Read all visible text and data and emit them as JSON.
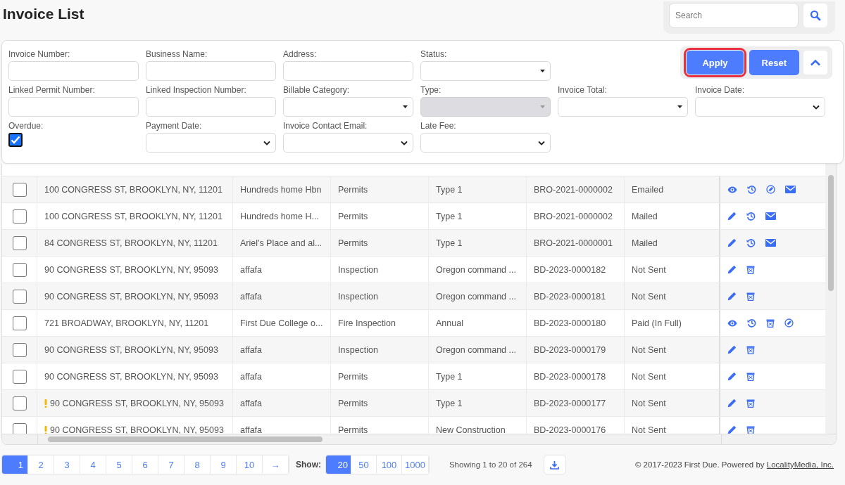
{
  "title": "Invoice List",
  "search": {
    "placeholder": "Search"
  },
  "filters": [
    {
      "label": "Invoice Number:",
      "kind": "text"
    },
    {
      "label": "Business Name:",
      "kind": "text"
    },
    {
      "label": "Address:",
      "kind": "text"
    },
    {
      "label": "Status:",
      "kind": "dropdown",
      "disabled": false
    },
    {
      "label": "Linked Permit Number:",
      "kind": "text"
    },
    {
      "label": "Linked Inspection Number:",
      "kind": "text"
    },
    {
      "label": "Billable Category:",
      "kind": "dropdown",
      "disabled": false
    },
    {
      "label": "Type:",
      "kind": "dropdown",
      "disabled": true
    },
    {
      "label": "Invoice Total:",
      "kind": "dropdown",
      "disabled": false
    },
    {
      "label": "Invoice Date:",
      "kind": "select",
      "disabled": false
    },
    {
      "label": "Overdue:",
      "kind": "checkbox",
      "checked": true
    },
    {
      "label": "Payment Date:",
      "kind": "select",
      "disabled": false
    },
    {
      "label": "Invoice Contact Email:",
      "kind": "select",
      "disabled": false
    },
    {
      "label": "Late Fee:",
      "kind": "select",
      "disabled": false
    }
  ],
  "filter_buttons": [
    {
      "label": "Apply",
      "focused": true
    },
    {
      "label": "Reset",
      "focused": false
    }
  ],
  "rows": [
    {
      "checked": false,
      "warning": false,
      "address": "100 CONGRESS ST, BROOKLYN, NY, 11201",
      "business": "Hundreds home Hbn",
      "category": "Permits",
      "type": "Type 1",
      "number": "BRO-2021-0000002",
      "status": "Emailed",
      "actions": [
        {
          "kind": "view"
        },
        {
          "kind": "history"
        },
        {
          "kind": "paid"
        },
        {
          "kind": "email"
        }
      ]
    },
    {
      "checked": false,
      "warning": false,
      "address": "100 CONGRESS ST, BROOKLYN, NY, 11201",
      "business": "Hundreds home H...",
      "category": "Permits",
      "type": "Type 1",
      "number": "BRO-2021-0000002",
      "status": "Mailed",
      "actions": [
        {
          "kind": "edit"
        },
        {
          "kind": "history"
        },
        {
          "kind": "email"
        }
      ]
    },
    {
      "checked": false,
      "warning": false,
      "address": "84 CONGRESS ST, BROOKLYN, NY, 11201",
      "business": "Ariel's Place and al...",
      "category": "Permits",
      "type": "Type 1",
      "number": "BRO-2021-0000001",
      "status": "Mailed",
      "actions": [
        {
          "kind": "edit"
        },
        {
          "kind": "history"
        },
        {
          "kind": "email"
        }
      ]
    },
    {
      "checked": false,
      "warning": false,
      "address": "90 CONGRESS ST, BROOKLYN, NY, 95093",
      "business": "affafa",
      "category": "Inspection",
      "type": "Oregon command ...",
      "number": "BD-2023-0000182",
      "status": "Not Sent",
      "actions": [
        {
          "kind": "edit"
        },
        {
          "kind": "delete"
        }
      ]
    },
    {
      "checked": false,
      "warning": false,
      "address": "90 CONGRESS ST, BROOKLYN, NY, 95093",
      "business": "affafa",
      "category": "Inspection",
      "type": "Oregon command ...",
      "number": "BD-2023-0000181",
      "status": "Not Sent",
      "actions": [
        {
          "kind": "edit"
        },
        {
          "kind": "delete"
        }
      ]
    },
    {
      "checked": false,
      "warning": false,
      "address": "721 BROADWAY, BROOKLYN, NY, 11201",
      "business": "First Due College o...",
      "category": "Fire Inspection",
      "type": "Annual",
      "number": "BD-2023-0000180",
      "status": "Paid (In Full)",
      "actions": [
        {
          "kind": "view"
        },
        {
          "kind": "history"
        },
        {
          "kind": "delete"
        },
        {
          "kind": "paid"
        }
      ]
    },
    {
      "checked": false,
      "warning": false,
      "address": "90 CONGRESS ST, BROOKLYN, NY, 95093",
      "business": "affafa",
      "category": "Inspection",
      "type": "Oregon command ...",
      "number": "BD-2023-0000179",
      "status": "Not Sent",
      "actions": [
        {
          "kind": "edit"
        },
        {
          "kind": "delete"
        }
      ]
    },
    {
      "checked": false,
      "warning": false,
      "address": "90 CONGRESS ST, BROOKLYN, NY, 95093",
      "business": "affafa",
      "category": "Permits",
      "type": "Type 1",
      "number": "BD-2023-0000178",
      "status": "Not Sent",
      "actions": [
        {
          "kind": "edit"
        },
        {
          "kind": "delete"
        }
      ]
    },
    {
      "checked": false,
      "warning": true,
      "address": "90 CONGRESS ST, BROOKLYN, NY, 95093",
      "business": "affafa",
      "category": "Permits",
      "type": "Type 1",
      "number": "BD-2023-0000177",
      "status": "Not Sent",
      "actions": [
        {
          "kind": "edit"
        },
        {
          "kind": "delete"
        }
      ]
    },
    {
      "checked": false,
      "warning": true,
      "address": "90 CONGRESS ST, BROOKLYN, NY, 95093",
      "business": "affafa",
      "category": "Permits",
      "type": "New Construction",
      "number": "BD-2023-0000176",
      "status": "Not Sent",
      "actions": [
        {
          "kind": "edit"
        },
        {
          "kind": "delete"
        }
      ]
    }
  ],
  "pages": [
    {
      "label": "1",
      "selected": true
    },
    {
      "label": "2",
      "selected": false
    },
    {
      "label": "3",
      "selected": false
    },
    {
      "label": "4",
      "selected": false
    },
    {
      "label": "5",
      "selected": false
    },
    {
      "label": "6",
      "selected": false
    },
    {
      "label": "7",
      "selected": false
    },
    {
      "label": "8",
      "selected": false
    },
    {
      "label": "9",
      "selected": false
    },
    {
      "label": "10",
      "selected": false
    },
    {
      "label": "→",
      "selected": false
    }
  ],
  "show": {
    "label": "Show:",
    "options": [
      {
        "label": "20",
        "selected": true
      },
      {
        "label": "50",
        "selected": false
      },
      {
        "label": "100",
        "selected": false
      },
      {
        "label": "1000",
        "selected": false
      }
    ]
  },
  "summary": "Showing 1 to 20 of 264",
  "footer": {
    "text": "© 2017-2023 First Due. Powered by ",
    "link": "LocalityMedia, Inc."
  }
}
